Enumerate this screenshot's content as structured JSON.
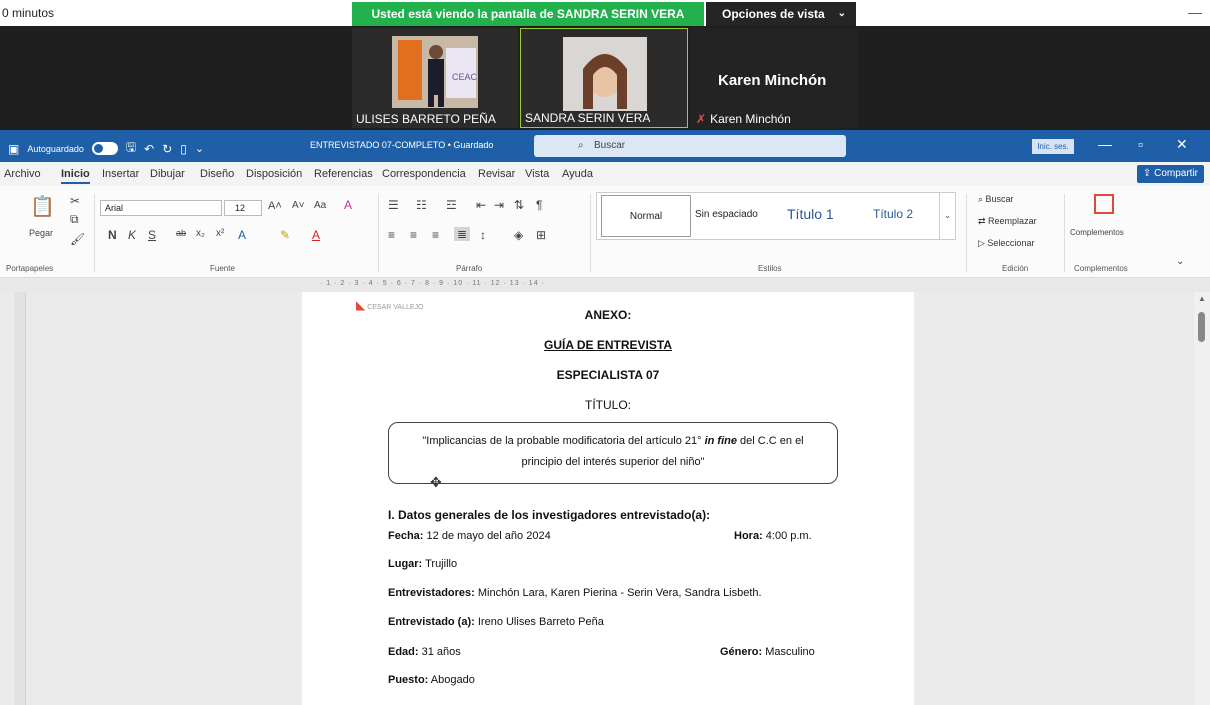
{
  "zoom": {
    "elapsed": "0 minutos",
    "viewing_banner": "Usted está viendo la pantalla de SANDRA SERIN VERA",
    "view_options": "Opciones de vista",
    "participants": [
      {
        "name": "ULISES BARRETO PEÑA"
      },
      {
        "name": "SANDRA SERIN VERA"
      },
      {
        "name": "Karen Minchón",
        "display": "Karen Minchón"
      }
    ]
  },
  "word": {
    "autosave": "Autoguardado",
    "doc_title": "ENTREVISTADO 07-COMPLETO • Guardado",
    "search_placeholder": "Buscar",
    "sign_in": "Inic. ses.",
    "tabs": [
      "Archivo",
      "Inicio",
      "Insertar",
      "Dibujar",
      "Diseño",
      "Disposición",
      "Referencias",
      "Correspondencia",
      "Revisar",
      "Vista",
      "Ayuda"
    ],
    "share": "Compartir",
    "ribbon": {
      "paste": "Pegar",
      "font_name": "Arial",
      "font_size": "12",
      "groups": {
        "clipboard": "Portapapeles",
        "font": "Fuente",
        "paragraph": "Párrafo",
        "styles": "Estilos",
        "editing": "Edición",
        "addins": "Complementos"
      },
      "styles": [
        "Normal",
        "Sin espaciado",
        "Título 1",
        "Título 2"
      ],
      "editing": [
        "Buscar",
        "Reemplazar",
        "Seleccionar"
      ],
      "addins_label": "Complementos"
    },
    "ruler_marks": "· 1 · 2 · 3 · 4 · 5 · 6 · 7 · 8 · 9 · 10 · 11 · 12 · 13 · 14 ·"
  },
  "document": {
    "logo_text": "CESAR VALLEJO",
    "anexo": "ANEXO:",
    "guide": "GUÍA DE ENTREVISTA",
    "specialist": "ESPECIALISTA 07",
    "title_label": "TÍTULO:",
    "title_line1_a": "\"Implicancias de la probable modificatoria del artículo 21° ",
    "title_line1_em": "in fine",
    "title_line1_b": " del C.C en el",
    "title_line2": "principio del interés superior del niño\"",
    "section": "I.  Datos generales de los investigadores entrevistado(a):",
    "fecha_label": "Fecha:",
    "fecha_value": "12 de mayo del año 2024",
    "hora_label": "Hora:",
    "hora_value": "4:00 p.m.",
    "lugar_label": "Lugar:",
    "lugar_value": "Trujillo",
    "entrevistadores_label": "Entrevistadores:",
    "entrevistadores_value": "Minchón Lara, Karen Pierina - Serin Vera, Sandra Lisbeth.",
    "entrevistado_label": "Entrevistado (a):",
    "entrevistado_value": "Ireno Ulises Barreto Peña",
    "edad_label": "Edad:",
    "edad_value": "31 años",
    "genero_label": "Género:",
    "genero_value": "Masculino",
    "puesto_label": "Puesto:",
    "puesto_value": "Abogado"
  },
  "colors": {
    "word_blue": "#1e5fa8",
    "zoom_green": "#22b14c"
  }
}
